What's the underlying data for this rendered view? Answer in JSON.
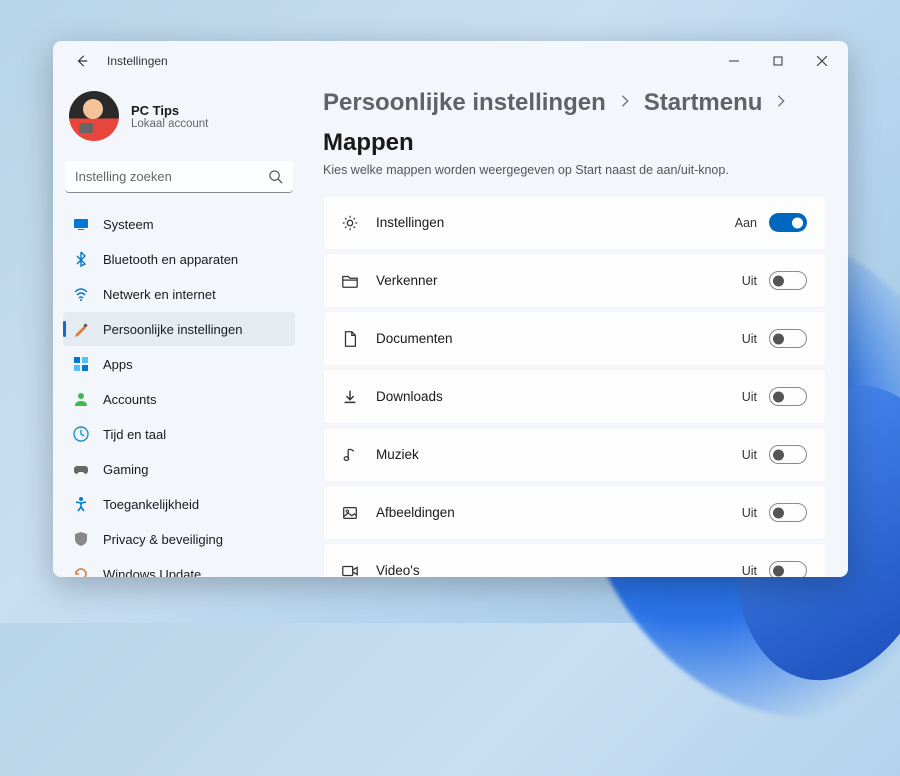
{
  "window": {
    "title": "Instellingen"
  },
  "profile": {
    "name": "PC Tips",
    "subtitle": "Lokaal account"
  },
  "search": {
    "placeholder": "Instelling zoeken"
  },
  "sidebar": {
    "items": [
      {
        "id": "system",
        "label": "Systeem"
      },
      {
        "id": "bluetooth",
        "label": "Bluetooth en apparaten"
      },
      {
        "id": "network",
        "label": "Netwerk en internet"
      },
      {
        "id": "personalization",
        "label": "Persoonlijke instellingen"
      },
      {
        "id": "apps",
        "label": "Apps"
      },
      {
        "id": "accounts",
        "label": "Accounts"
      },
      {
        "id": "time",
        "label": "Tijd en taal"
      },
      {
        "id": "gaming",
        "label": "Gaming"
      },
      {
        "id": "accessibility",
        "label": "Toegankelijkheid"
      },
      {
        "id": "privacy",
        "label": "Privacy & beveiliging"
      },
      {
        "id": "update",
        "label": "Windows Update"
      }
    ],
    "activeIndex": 3
  },
  "breadcrumb": {
    "parts": [
      "Persoonlijke instellingen",
      "Startmenu",
      "Mappen"
    ]
  },
  "subtitle": "Kies welke mappen worden weergegeven op Start naast de aan/uit-knop.",
  "toggleLabels": {
    "on": "Aan",
    "off": "Uit"
  },
  "folders": [
    {
      "id": "settings",
      "label": "Instellingen",
      "on": true
    },
    {
      "id": "explorer",
      "label": "Verkenner",
      "on": false
    },
    {
      "id": "documents",
      "label": "Documenten",
      "on": false
    },
    {
      "id": "downloads",
      "label": "Downloads",
      "on": false
    },
    {
      "id": "music",
      "label": "Muziek",
      "on": false
    },
    {
      "id": "pictures",
      "label": "Afbeeldingen",
      "on": false
    },
    {
      "id": "videos",
      "label": "Video's",
      "on": false
    }
  ]
}
